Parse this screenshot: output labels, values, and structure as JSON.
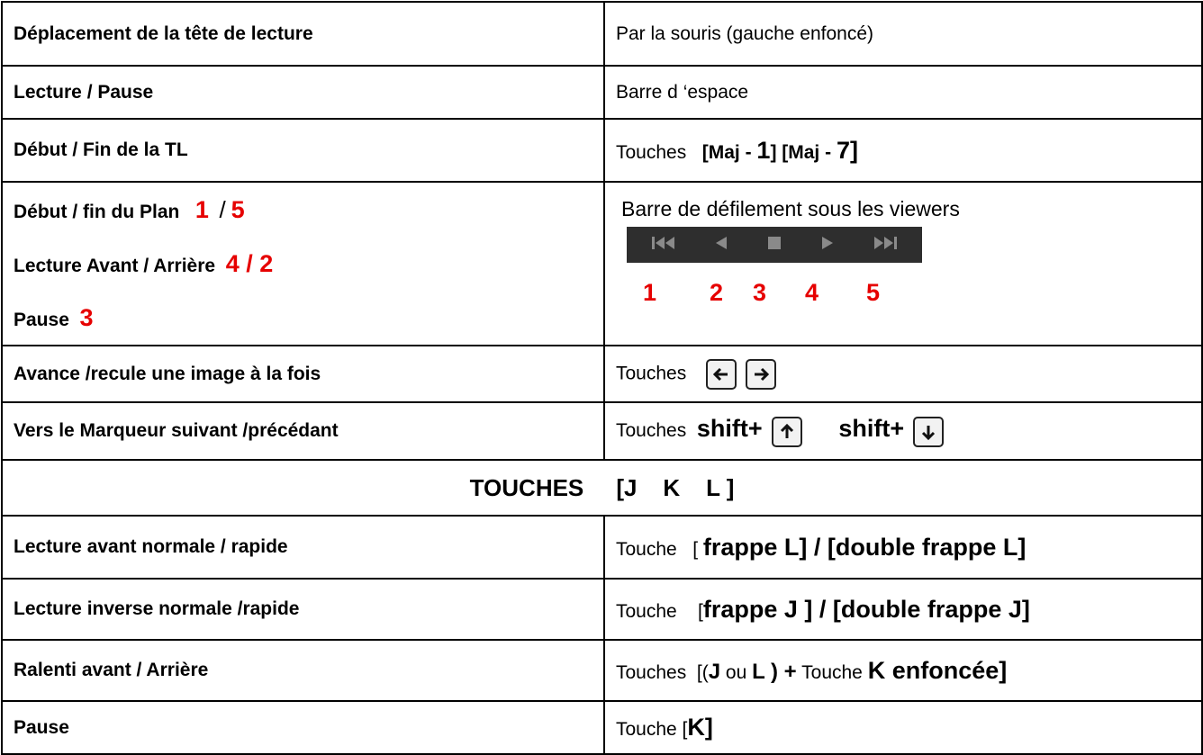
{
  "rows": [
    {
      "left": "Déplacement de la tête de lecture",
      "right": "Par la souris  (gauche enfoncé)"
    },
    {
      "left": "Lecture / Pause",
      "right": "Barre d ‘espace"
    },
    {
      "left": "Début / Fin de la TL",
      "right_prefix": "Touches",
      "right_keys": "[Maj - ",
      "k1": "1",
      "mid": "] [Maj - ",
      "k2": "7",
      "end": "]"
    }
  ],
  "plan": {
    "line1": "Début / fin du Plan",
    "n1": "1",
    "sep": "/",
    "n5": "5",
    "line2": "Lecture Avant / Arrière",
    "n42": "4 / 2",
    "line3": "Pause",
    "n3": "3",
    "right_title": "Barre de défilement sous les viewers",
    "numbers": [
      "1",
      "2",
      "3",
      "4",
      "5"
    ]
  },
  "arrow_row": {
    "left": "Avance /recule  une image à la fois",
    "right": "Touches"
  },
  "marker_row": {
    "left": "Vers le Marqueur  suivant /précédant",
    "right": "Touches",
    "shift": "shift+"
  },
  "jkl_header": "TOUCHES     [J    K    L ]",
  "jkl_rows": [
    {
      "left": "Lecture   avant normale / rapide",
      "prefix": "Touche   [ ",
      "k": "frappe L]  / [double frappe L]"
    },
    {
      "left": "Lecture inverse normale /rapide",
      "prefix": "Touche    [",
      "k": "frappe J ] / [double frappe J]"
    },
    {
      "left": "Ralenti avant  / Arrière",
      "prefix": "Touches  [(",
      "j": "J",
      "ou": " ou ",
      "l": "L ) +",
      "touche": " Touche ",
      "kf": "K enfoncée]"
    },
    {
      "left": "Pause",
      "prefix": "Touche [",
      "k": "K]"
    }
  ]
}
